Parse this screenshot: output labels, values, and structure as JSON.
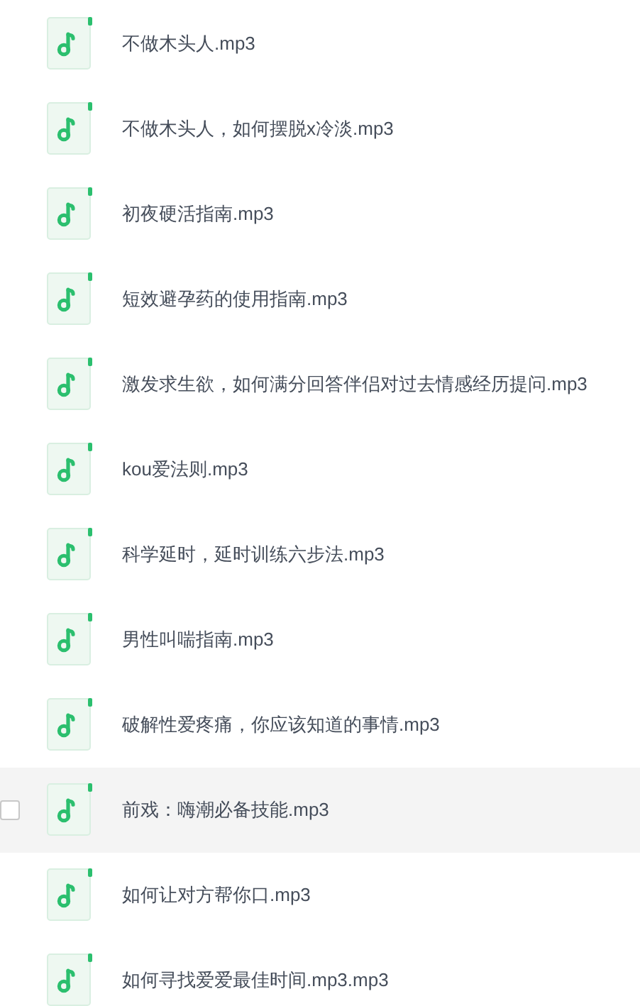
{
  "files": [
    {
      "name": "不做木头人.mp3",
      "hovered": false,
      "checked": false
    },
    {
      "name": "不做木头人，如何摆脱x冷淡.mp3",
      "hovered": false,
      "checked": false
    },
    {
      "name": "初夜硬活指南.mp3",
      "hovered": false,
      "checked": false
    },
    {
      "name": "短效避孕药的使用指南.mp3",
      "hovered": false,
      "checked": false
    },
    {
      "name": "激发求生欲，如何满分回答伴侣对过去情感经历提问.mp3",
      "hovered": false,
      "checked": false
    },
    {
      "name": "kou爱法则.mp3",
      "hovered": false,
      "checked": false
    },
    {
      "name": "科学延时，延时训练六步法.mp3",
      "hovered": false,
      "checked": false
    },
    {
      "name": "男性叫喘指南.mp3",
      "hovered": false,
      "checked": false
    },
    {
      "name": "破解性爱疼痛，你应该知道的事情.mp3",
      "hovered": false,
      "checked": false
    },
    {
      "name": "前戏：嗨潮必备技能.mp3",
      "hovered": true,
      "checked": false
    },
    {
      "name": "如何让对方帮你口.mp3",
      "hovered": false,
      "checked": false
    },
    {
      "name": "如何寻找爱爱最佳时间.mp3.mp3",
      "hovered": false,
      "checked": false
    }
  ]
}
